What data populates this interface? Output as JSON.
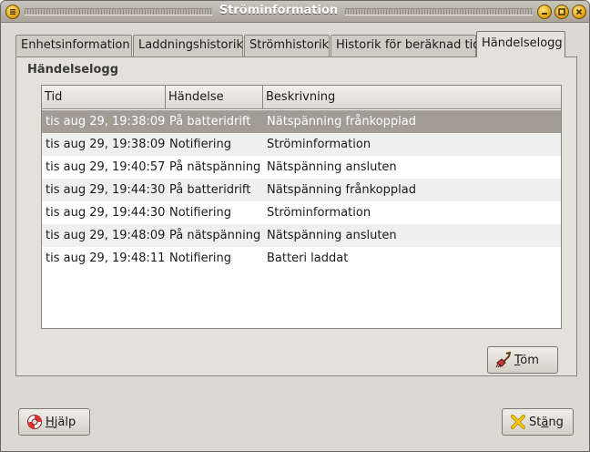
{
  "window": {
    "title": "Ströminformation"
  },
  "tabs": [
    {
      "label": "Enhetsinformation",
      "active": false
    },
    {
      "label": "Laddningshistorik",
      "active": false
    },
    {
      "label": "Strömhistorik",
      "active": false
    },
    {
      "label": "Historik för beräknad tid",
      "active": false
    },
    {
      "label": "Händelselogg",
      "active": true
    }
  ],
  "panel": {
    "title": "Händelselogg"
  },
  "table": {
    "columns": [
      "Tid",
      "Händelse",
      "Beskrivning"
    ],
    "rows": [
      {
        "tid": "tis aug 29, 19:38:09",
        "handelse": "På batteridrift",
        "beskrivning": "Nätspänning frånkopplad",
        "selected": true
      },
      {
        "tid": "tis aug 29, 19:38:09",
        "handelse": "Notifiering",
        "beskrivning": "Ströminformation"
      },
      {
        "tid": "tis aug 29, 19:40:57",
        "handelse": "På nätspänning",
        "beskrivning": "Nätspänning ansluten"
      },
      {
        "tid": "tis aug 29, 19:44:30",
        "handelse": "På batteridrift",
        "beskrivning": "Nätspänning frånkopplad"
      },
      {
        "tid": "tis aug 29, 19:44:30",
        "handelse": "Notifiering",
        "beskrivning": "Ströminformation"
      },
      {
        "tid": "tis aug 29, 19:48:09",
        "handelse": "På nätspänning",
        "beskrivning": "Nätspänning ansluten"
      },
      {
        "tid": "tis aug 29, 19:48:11",
        "handelse": "Notifiering",
        "beskrivning": "Batteri laddat"
      }
    ]
  },
  "buttons": {
    "clear": {
      "mnemonic": "T",
      "rest": "öm",
      "icon": "broom-icon"
    },
    "help": {
      "mnemonic": "H",
      "rest": "jälp",
      "icon": "lifebuoy-icon"
    },
    "close": {
      "prefix": "St",
      "mnemonic": "ä",
      "rest": "ng",
      "icon": "close-x-icon"
    }
  },
  "colors": {
    "selection": "#a19d95",
    "window_bg": "#dcd9d2",
    "titlebar_button": "#e4a717"
  }
}
